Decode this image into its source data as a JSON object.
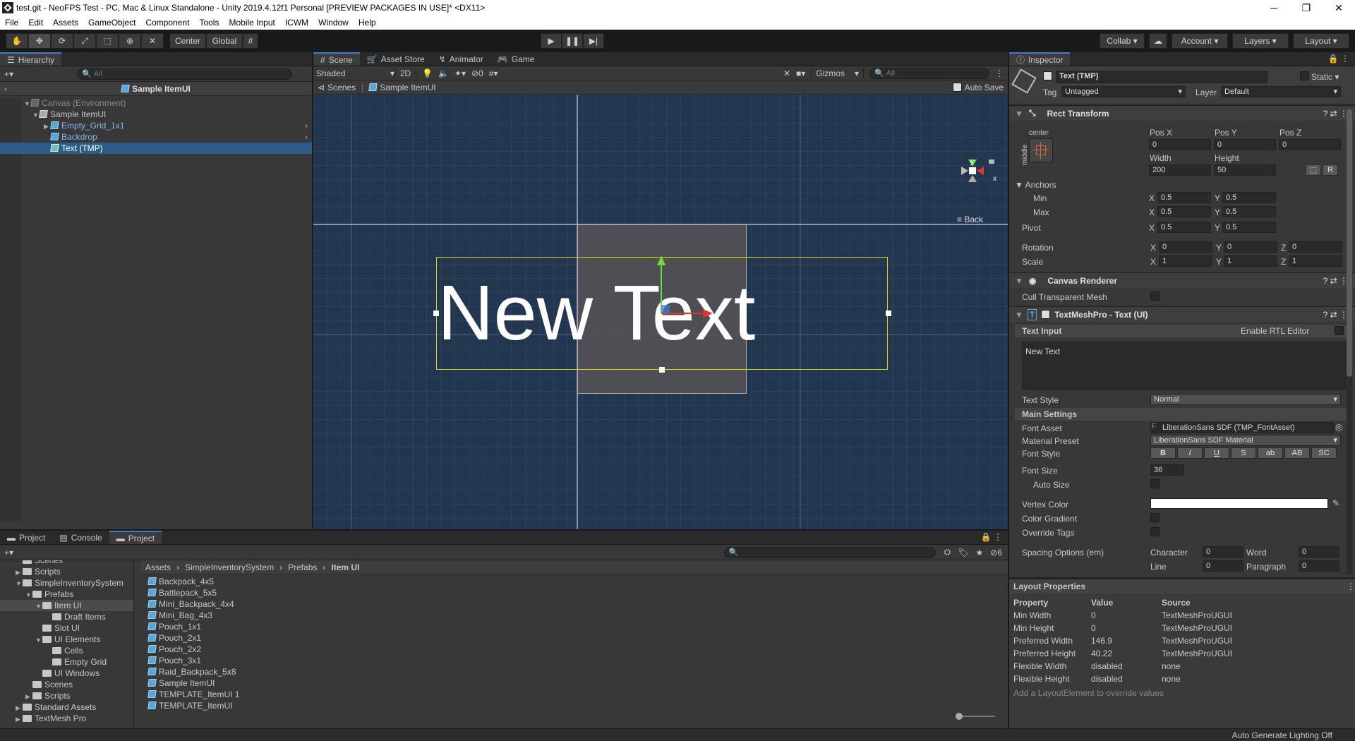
{
  "window": {
    "title": "test.git - NeoFPS Test - PC, Mac & Linux Standalone - Unity 2019.4.12f1 Personal [PREVIEW PACKAGES IN USE]* <DX11>",
    "minimize": "─",
    "maximize": "❐",
    "close": "✕"
  },
  "menu": [
    "File",
    "Edit",
    "Assets",
    "GameObject",
    "Component",
    "Tools",
    "Mobile Input",
    "ICWM",
    "Window",
    "Help"
  ],
  "toolbar": {
    "center": "Center",
    "global": "Global",
    "collab": "Collab ▾",
    "account": "Account",
    "layers": "Layers",
    "layout": "Layout"
  },
  "hierarchy": {
    "tab": "Hierarchy",
    "search_placeholder": "All",
    "title": "Sample ItemUI",
    "items": [
      {
        "label": "Canvas (Environment)"
      },
      {
        "label": "Sample ItemUI"
      },
      {
        "label": "Empty_Grid_1x1"
      },
      {
        "label": "Backdrop"
      },
      {
        "label": "Text (TMP)"
      }
    ]
  },
  "scene": {
    "tabs": [
      "Scene",
      "Asset Store",
      "Animator",
      "Game"
    ],
    "shaded": "Shaded",
    "two_d": "2D",
    "hidden_count": "0",
    "gizmos": "Gizmos",
    "search_placeholder": "All",
    "breadcrumb_scenes": "Scenes",
    "breadcrumb_item": "Sample ItemUI",
    "auto_save": "Auto Save",
    "canvas_text": "New Text",
    "gizmo_back": "Back",
    "gizmo_y": "y",
    "gizmo_x": "x"
  },
  "inspector": {
    "tab": "Inspector",
    "object_name": "Text (TMP)",
    "static": "Static",
    "tag_label": "Tag",
    "tag": "Untagged",
    "layer_label": "Layer",
    "layer": "Default",
    "rect_transform": {
      "title": "Rect Transform",
      "anchor_h": "center",
      "anchor_v": "middle",
      "pos_x_label": "Pos X",
      "pos_y_label": "Pos Y",
      "pos_z_label": "Pos Z",
      "pos_x": "0",
      "pos_y": "0",
      "pos_z": "0",
      "width_label": "Width",
      "height_label": "Height",
      "width": "200",
      "height": "50",
      "anchors_label": "Anchors",
      "min_label": "Min",
      "max_label": "Max",
      "pivot_label": "Pivot",
      "rotation_label": "Rotation",
      "scale_label": "Scale",
      "min_x": "0.5",
      "min_y": "0.5",
      "max_x": "0.5",
      "max_y": "0.5",
      "pivot_x": "0.5",
      "pivot_y": "0.5",
      "rot_x": "0",
      "rot_y": "0",
      "rot_z": "0",
      "scale_x": "1",
      "scale_y": "1",
      "scale_z": "1",
      "x": "X",
      "y": "Y",
      "z": "Z",
      "r_btn": "R"
    },
    "canvas_renderer": {
      "title": "Canvas Renderer",
      "cull_label": "Cull Transparent Mesh"
    },
    "tmp": {
      "title": "TextMeshPro - Text (UI)",
      "text_input_label": "Text Input",
      "rtl_label": "Enable RTL Editor",
      "text": "New Text",
      "text_style_label": "Text Style",
      "text_style": "Normal",
      "main_settings": "Main Settings",
      "font_asset_label": "Font Asset",
      "font_asset": "LiberationSans SDF (TMP_FontAsset)",
      "material_label": "Material Preset",
      "material": "LiberationSans SDF Material",
      "font_style_label": "Font Style",
      "font_styles": [
        "B",
        "I",
        "U",
        "S",
        "ab",
        "AB",
        "SC"
      ],
      "font_size_label": "Font Size",
      "font_size": "36",
      "auto_size_label": "Auto Size",
      "vertex_color_label": "Vertex Color",
      "color_gradient_label": "Color Gradient",
      "override_tags_label": "Override Tags",
      "spacing_label": "Spacing Options (em)",
      "character_label": "Character",
      "word_label": "Word",
      "line_label": "Line",
      "paragraph_label": "Paragraph",
      "character": "0",
      "word": "0",
      "line": "0",
      "paragraph": "0"
    },
    "layout": {
      "title": "Layout Properties",
      "headers": [
        "Property",
        "Value",
        "Source"
      ],
      "rows": [
        [
          "Min Width",
          "0",
          "TextMeshProUGUI"
        ],
        [
          "Min Height",
          "0",
          "TextMeshProUGUI"
        ],
        [
          "Preferred Width",
          "146.9",
          "TextMeshProUGUI"
        ],
        [
          "Preferred Height",
          "40.22",
          "TextMeshProUGUI"
        ],
        [
          "Flexible Width",
          "disabled",
          "none"
        ],
        [
          "Flexible Height",
          "disabled",
          "none"
        ]
      ],
      "footer": "Add a LayoutElement to override values"
    }
  },
  "project": {
    "tabs": [
      "Project",
      "Console",
      "Project"
    ],
    "hidden_count": "6",
    "breadcrumb": [
      "Assets",
      "SimpleInventorySystem",
      "Prefabs",
      "Item UI"
    ],
    "tree": [
      {
        "label": "Scenes"
      },
      {
        "label": "Scripts"
      },
      {
        "label": "SimpleInventorySystem"
      },
      {
        "label": "Prefabs"
      },
      {
        "label": "Item UI"
      },
      {
        "label": "Draft Items"
      },
      {
        "label": "Slot UI"
      },
      {
        "label": "UI Elements"
      },
      {
        "label": "Cells"
      },
      {
        "label": "Empty Grid"
      },
      {
        "label": "UI Windows"
      },
      {
        "label": "Scenes"
      },
      {
        "label": "Scripts"
      },
      {
        "label": "Standard Assets"
      },
      {
        "label": "TextMesh Pro"
      }
    ],
    "assets": [
      "Backpack_4x5",
      "Battlepack_5x5",
      "Mini_Backpack_4x4",
      "Mini_Bag_4x3",
      "Pouch_1x1",
      "Pouch_2x1",
      "Pouch_2x2",
      "Pouch_3x1",
      "Raid_Backpack_5x8",
      "Sample ItemUI",
      "TEMPLATE_ItemUI 1",
      "TEMPLATE_ItemUI"
    ]
  },
  "status": {
    "text": "Auto Generate Lighting Off"
  }
}
